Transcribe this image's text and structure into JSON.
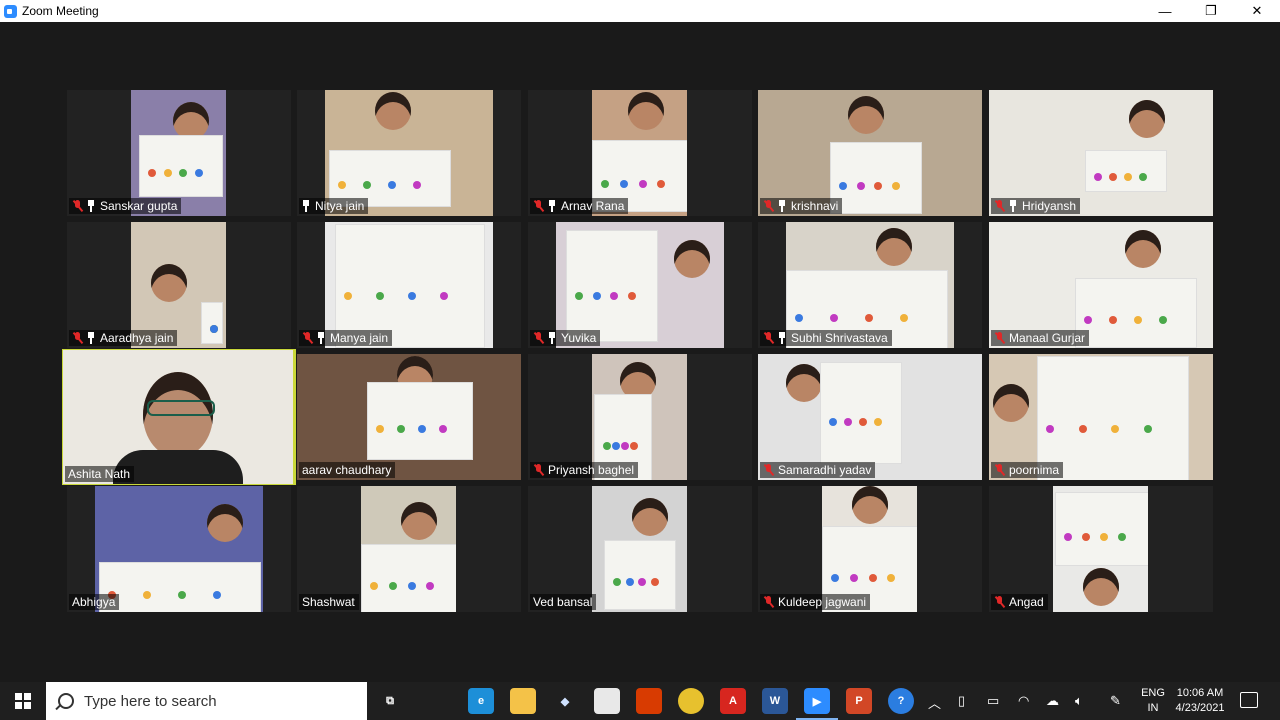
{
  "window": {
    "title": "Zoom Meeting",
    "controls": [
      "—",
      "❐",
      "✕"
    ]
  },
  "participants": [
    {
      "name": "Sanskar gupta",
      "muted": true,
      "pinned": true
    },
    {
      "name": "Nitya jain",
      "muted": false,
      "pinned": true
    },
    {
      "name": "Arnav Rana",
      "muted": true,
      "pinned": true
    },
    {
      "name": "krishnavi",
      "muted": true,
      "pinned": true
    },
    {
      "name": "Hridyansh",
      "muted": true,
      "pinned": true
    },
    {
      "name": "Aaradhya jain",
      "muted": true,
      "pinned": true
    },
    {
      "name": "Manya jain",
      "muted": true,
      "pinned": true
    },
    {
      "name": "Yuvika",
      "muted": true,
      "pinned": true
    },
    {
      "name": "Subhi Shrivastava",
      "muted": true,
      "pinned": true
    },
    {
      "name": "Manaal Gurjar",
      "muted": true,
      "pinned": false
    },
    {
      "name": "Ashita Nath",
      "muted": false,
      "pinned": false,
      "active_speaker": true
    },
    {
      "name": "aarav chaudhary",
      "muted": false,
      "pinned": false
    },
    {
      "name": "Priyansh baghel",
      "muted": true,
      "pinned": false
    },
    {
      "name": "Samaradhi yadav",
      "muted": true,
      "pinned": false
    },
    {
      "name": "poornima",
      "muted": true,
      "pinned": false
    },
    {
      "name": "Abhigya",
      "muted": false,
      "pinned": false
    },
    {
      "name": "Shashwat",
      "muted": false,
      "pinned": false
    },
    {
      "name": "Ved bansal",
      "muted": false,
      "pinned": false
    },
    {
      "name": "Kuldeep jagwani",
      "muted": true,
      "pinned": false
    },
    {
      "name": "Angad",
      "muted": true,
      "pinned": false
    }
  ],
  "taskbar": {
    "search_placeholder": "Type here to search",
    "language": "ENG",
    "region": "IN",
    "time": "10:06 AM",
    "date": "4/23/2021",
    "apps": [
      "task-view",
      "edge",
      "file-explorer",
      "dropbox",
      "store",
      "office",
      "chrome",
      "acrobat",
      "word",
      "zoom",
      "powerpoint",
      "help"
    ]
  },
  "colors": {
    "active_speaker_border": "#c9d83a",
    "muted_mic": "#e02828",
    "zoom_blue": "#2d8cff"
  }
}
